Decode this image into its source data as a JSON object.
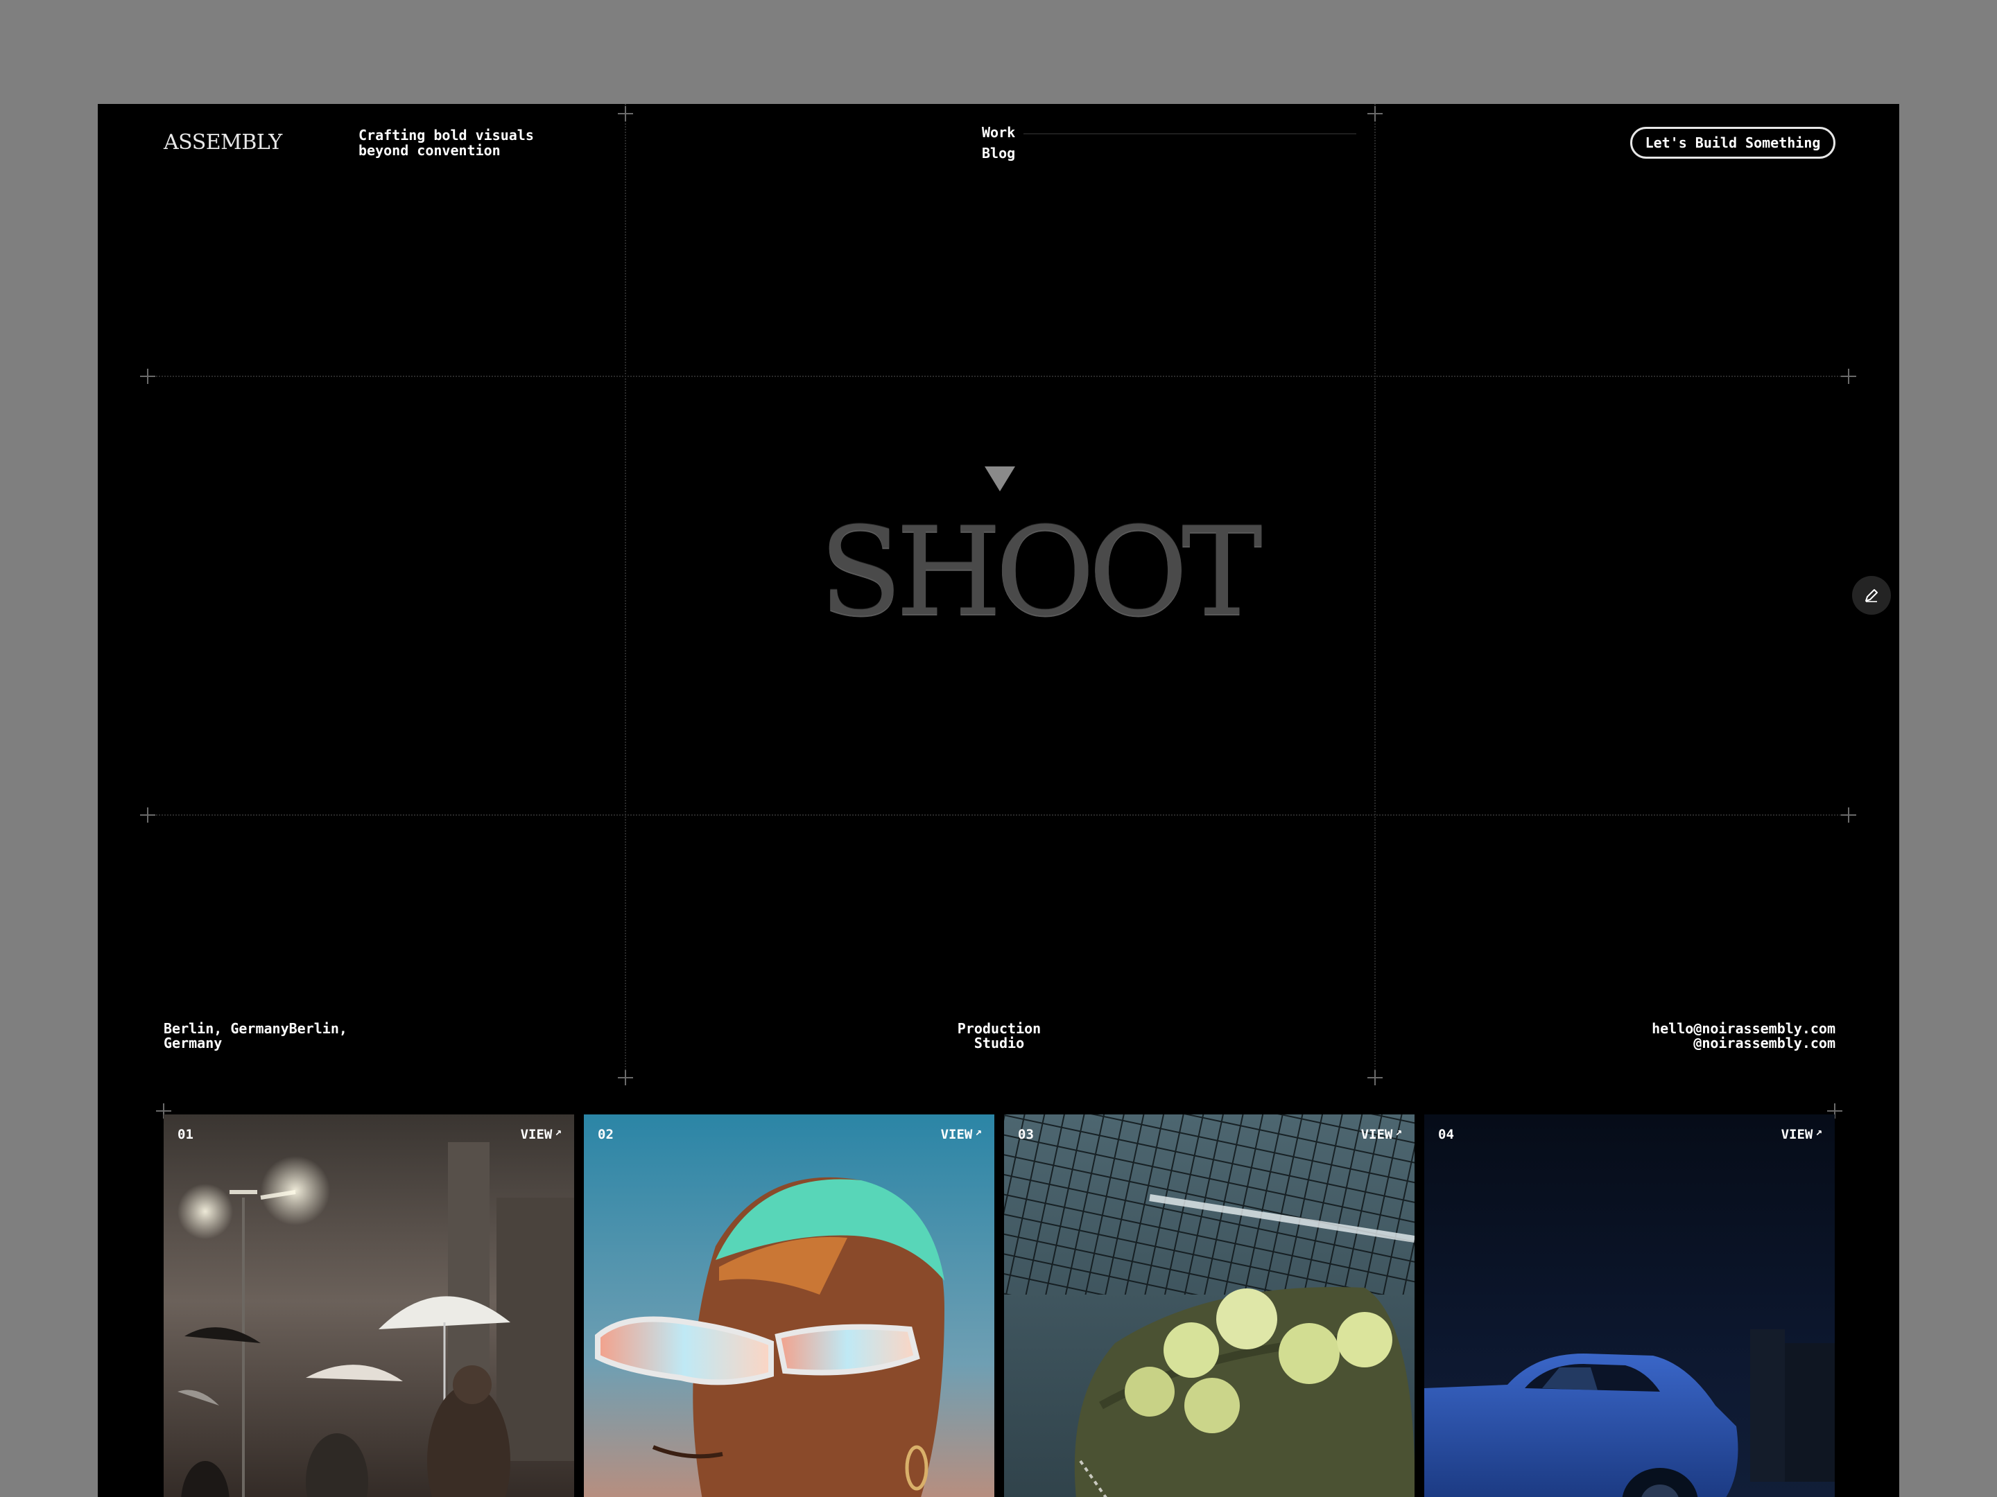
{
  "header": {
    "logo": "ASSEMBLY",
    "tagline_line1": "Crafting bold visuals",
    "tagline_line2": "beyond convention",
    "nav": [
      {
        "label": "Work"
      },
      {
        "label": "Blog"
      }
    ],
    "cta_label": "Let's Build Something"
  },
  "hero": {
    "title": "SHOOT"
  },
  "info": {
    "location_line1": "Berlin, GermanyBerlin,",
    "location_line2": "Germany",
    "studio_line1": "Production",
    "studio_line2": "Studio",
    "email": "hello@noirassembly.com",
    "handle": "@noirassembly.com"
  },
  "projects": [
    {
      "number": "01",
      "view_label": "VIEW",
      "icon": "arrow-up-right-icon"
    },
    {
      "number": "02",
      "view_label": "VIEW",
      "icon": "arrow-up-right-icon"
    },
    {
      "number": "03",
      "view_label": "VIEW",
      "icon": "arrow-up-right-icon"
    },
    {
      "number": "04",
      "view_label": "VIEW",
      "icon": "arrow-up-right-icon"
    }
  ],
  "icons": {
    "edit": "pencil-icon",
    "hero_marker": "triangle-down-icon"
  },
  "colors": {
    "page_bg": "#7f7f7f",
    "frame_bg": "#000000",
    "text": "#ffffff",
    "hero_title": "#4a4a4a"
  }
}
